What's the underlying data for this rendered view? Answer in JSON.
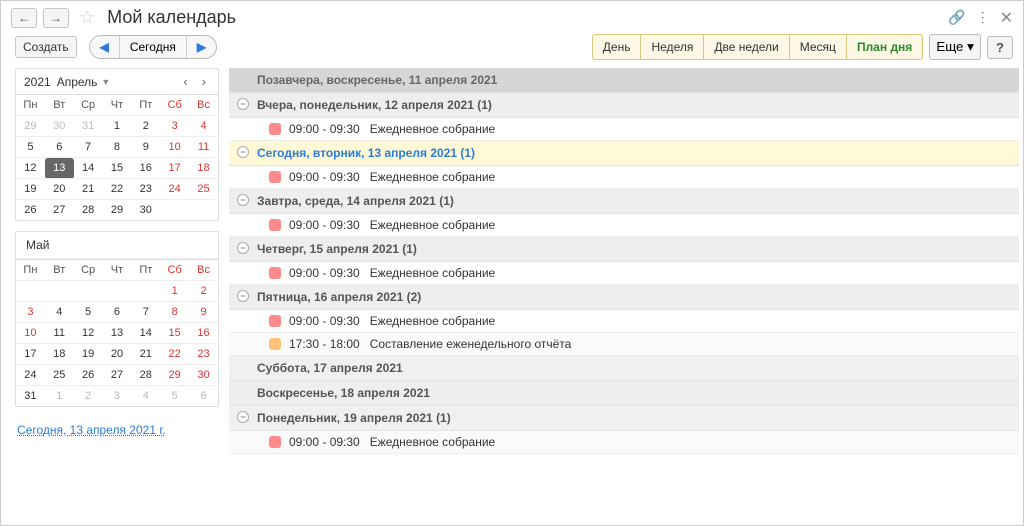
{
  "header": {
    "title": "Мой календарь"
  },
  "toolbar": {
    "create": "Создать",
    "today": "Сегодня",
    "views": [
      "День",
      "Неделя",
      "Две недели",
      "Месяц",
      "План дня"
    ],
    "active_view_index": 4,
    "more": "Еще",
    "help": "?"
  },
  "sidebar": {
    "year": "2021",
    "month1": "Апрель",
    "month2": "Май",
    "dow": [
      "Пн",
      "Вт",
      "Ср",
      "Чт",
      "Пт",
      "Сб",
      "Вс"
    ],
    "cal1_rows": [
      [
        {
          "d": "29",
          "other": true
        },
        {
          "d": "30",
          "other": true
        },
        {
          "d": "31",
          "other": true
        },
        {
          "d": "1"
        },
        {
          "d": "2"
        },
        {
          "d": "3",
          "we": true
        },
        {
          "d": "4",
          "we": true
        }
      ],
      [
        {
          "d": "5"
        },
        {
          "d": "6"
        },
        {
          "d": "7"
        },
        {
          "d": "8"
        },
        {
          "d": "9"
        },
        {
          "d": "10",
          "we": true
        },
        {
          "d": "11",
          "we": true
        }
      ],
      [
        {
          "d": "12"
        },
        {
          "d": "13",
          "sel": true
        },
        {
          "d": "14"
        },
        {
          "d": "15"
        },
        {
          "d": "16"
        },
        {
          "d": "17",
          "we": true
        },
        {
          "d": "18",
          "we": true
        }
      ],
      [
        {
          "d": "19"
        },
        {
          "d": "20"
        },
        {
          "d": "21"
        },
        {
          "d": "22"
        },
        {
          "d": "23"
        },
        {
          "d": "24",
          "we": true
        },
        {
          "d": "25",
          "we": true
        }
      ],
      [
        {
          "d": "26"
        },
        {
          "d": "27"
        },
        {
          "d": "28"
        },
        {
          "d": "29"
        },
        {
          "d": "30"
        },
        {
          "d": "",
          "we": true
        },
        {
          "d": "",
          "we": true
        }
      ]
    ],
    "cal2_rows": [
      [
        {
          "d": ""
        },
        {
          "d": ""
        },
        {
          "d": ""
        },
        {
          "d": ""
        },
        {
          "d": ""
        },
        {
          "d": "1",
          "we": true
        },
        {
          "d": "2",
          "we": true
        }
      ],
      [
        {
          "d": "3",
          "we": true
        },
        {
          "d": "4"
        },
        {
          "d": "5"
        },
        {
          "d": "6"
        },
        {
          "d": "7"
        },
        {
          "d": "8",
          "we": true
        },
        {
          "d": "9",
          "we": true
        }
      ],
      [
        {
          "d": "10",
          "we": true
        },
        {
          "d": "11"
        },
        {
          "d": "12"
        },
        {
          "d": "13"
        },
        {
          "d": "14"
        },
        {
          "d": "15",
          "we": true
        },
        {
          "d": "16",
          "we": true
        }
      ],
      [
        {
          "d": "17"
        },
        {
          "d": "18"
        },
        {
          "d": "19"
        },
        {
          "d": "20"
        },
        {
          "d": "21"
        },
        {
          "d": "22",
          "we": true
        },
        {
          "d": "23",
          "we": true
        }
      ],
      [
        {
          "d": "24"
        },
        {
          "d": "25"
        },
        {
          "d": "26"
        },
        {
          "d": "27"
        },
        {
          "d": "28"
        },
        {
          "d": "29",
          "we": true
        },
        {
          "d": "30",
          "we": true
        }
      ],
      [
        {
          "d": "31"
        },
        {
          "d": "1",
          "other": true
        },
        {
          "d": "2",
          "other": true
        },
        {
          "d": "3",
          "other": true
        },
        {
          "d": "4",
          "other": true
        },
        {
          "d": "5",
          "other": true,
          "we": true
        },
        {
          "d": "6",
          "other": true,
          "we": true
        }
      ]
    ],
    "today_link": "Сегодня, 13 апреля 2021 г."
  },
  "agenda": [
    {
      "type": "header",
      "first": true,
      "label": "Позавчера, воскресенье, 11 апреля 2021"
    },
    {
      "type": "header",
      "toggle": true,
      "label": "Вчера, понедельник, 12 апреля 2021 (1)"
    },
    {
      "type": "event",
      "color": "red",
      "time": "09:00 - 09:30",
      "title": "Ежедневное собрание"
    },
    {
      "type": "header",
      "toggle": true,
      "today": true,
      "label": "Сегодня, вторник, 13 апреля 2021 (1)"
    },
    {
      "type": "event",
      "color": "red",
      "time": "09:00 - 09:30",
      "title": "Ежедневное собрание"
    },
    {
      "type": "header",
      "toggle": true,
      "label": "Завтра, среда, 14 апреля 2021 (1)"
    },
    {
      "type": "event",
      "color": "red",
      "time": "09:00 - 09:30",
      "title": "Ежедневное собрание"
    },
    {
      "type": "header",
      "toggle": true,
      "label": "Четверг, 15 апреля 2021 (1)"
    },
    {
      "type": "event",
      "color": "red",
      "time": "09:00 - 09:30",
      "title": "Ежедневное собрание"
    },
    {
      "type": "header",
      "toggle": true,
      "label": "Пятница, 16 апреля 2021 (2)"
    },
    {
      "type": "event",
      "color": "red",
      "time": "09:00 - 09:30",
      "title": "Ежедневное собрание"
    },
    {
      "type": "event",
      "color": "orange",
      "time": "17:30 - 18:00",
      "title": "Составление еженедельного отчёта"
    },
    {
      "type": "header",
      "label": "Суббота, 17 апреля 2021"
    },
    {
      "type": "header",
      "label": "Воскресенье, 18 апреля 2021"
    },
    {
      "type": "header",
      "toggle": true,
      "label": "Понедельник, 19 апреля 2021 (1)"
    },
    {
      "type": "event",
      "color": "red",
      "time": "09:00 - 09:30",
      "title": "Ежедневное собрание"
    }
  ]
}
